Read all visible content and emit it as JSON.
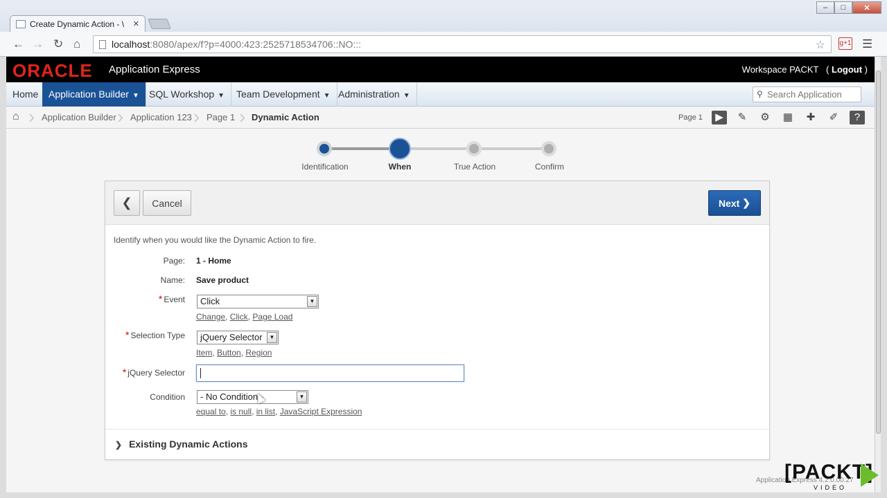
{
  "browser": {
    "tab_title": "Create Dynamic Action - \\",
    "tab_close": "✕",
    "window_controls": [
      "–",
      "□",
      "✕"
    ],
    "url_host": "localhost",
    "url_path": ":8080/apex/f?p=4000:423:2525718534706::NO:::",
    "ext_label": "g+1"
  },
  "header": {
    "logo": "ORACLE",
    "product": "Application Express",
    "workspace": "Workspace PACKT",
    "logout": "Logout"
  },
  "menu": {
    "items": [
      {
        "label": "Home",
        "active": false
      },
      {
        "label": "Application Builder",
        "active": true
      },
      {
        "label": "SQL Workshop",
        "active": false
      },
      {
        "label": "Team Development",
        "active": false
      },
      {
        "label": "Administration",
        "active": false
      }
    ],
    "search_placeholder": "Search Application"
  },
  "breadcrumb": {
    "items": [
      "Application Builder",
      "Application 123",
      "Page 1",
      "Dynamic Action"
    ],
    "page_label": "Page 1"
  },
  "wizard": {
    "steps": [
      "Identification",
      "When",
      "True Action",
      "Confirm"
    ],
    "current_step": "When"
  },
  "dialog": {
    "cancel_label": "Cancel",
    "next_label": "Next",
    "intro": "Identify when you would like the Dynamic Action to fire.",
    "page_label": "Page:",
    "page_value": "1 - Home",
    "name_label": "Name:",
    "name_value": "Save product",
    "event_label": "Event",
    "event_value": "Click",
    "event_links": [
      "Change",
      "Click",
      "Page Load"
    ],
    "selection_type_label": "Selection Type",
    "selection_type_value": "jQuery Selector",
    "selection_type_links": [
      "Item",
      "Button",
      "Region"
    ],
    "jquery_selector_label": "jQuery Selector",
    "jquery_selector_value": "",
    "condition_label": "Condition",
    "condition_value": "- No Condition -",
    "condition_links": [
      "equal to",
      "is null",
      "in list",
      "JavaScript Expression"
    ],
    "existing_label": "Existing Dynamic Actions"
  },
  "footer": {
    "version": "Application Express 4.2.0.00.27",
    "packt": "[PACKT]",
    "packt_sub": "VIDEO"
  },
  "colors": {
    "accent": "#1a5296",
    "oracle_red": "#e0241b",
    "packt_green": "#6cbd2d"
  }
}
